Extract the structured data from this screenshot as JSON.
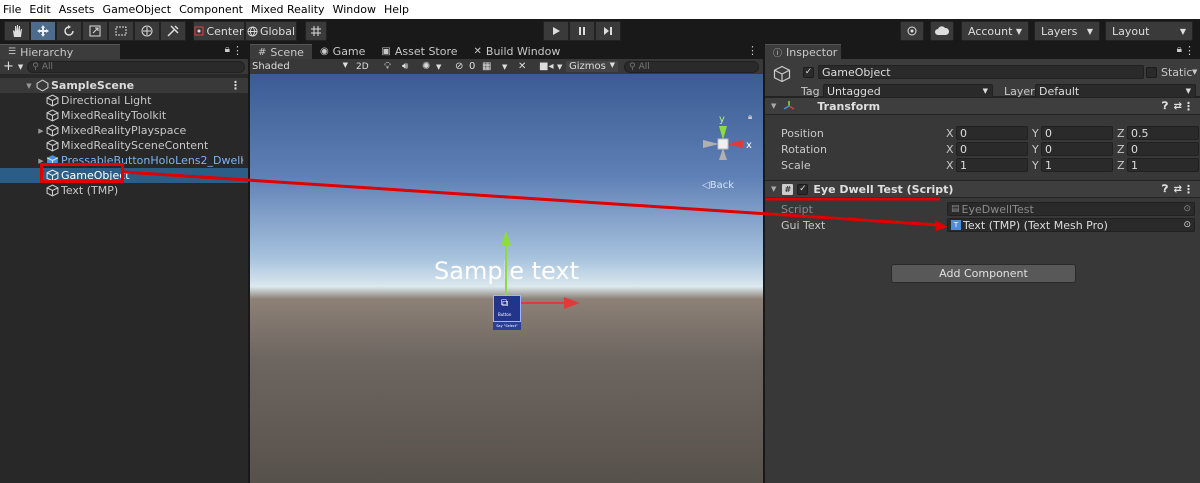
{
  "menu": [
    "File",
    "Edit",
    "Assets",
    "GameObject",
    "Component",
    "Mixed Reality",
    "Window",
    "Help"
  ],
  "toolbar": {
    "pivot_label": "Center",
    "space_label": "Global",
    "account_label": "Account",
    "layers_label": "Layers",
    "layout_label": "Layout"
  },
  "hierarchy": {
    "tab_label": "Hierarchy",
    "search_placeholder": "All",
    "scene_name": "SampleScene",
    "items": [
      {
        "label": "Directional Light"
      },
      {
        "label": "MixedRealityToolkit"
      },
      {
        "label": "MixedRealityPlayspace"
      },
      {
        "label": "MixedRealitySceneContent"
      },
      {
        "label": "PressableButtonHoloLens2_Dwell"
      },
      {
        "label": "GameObject"
      },
      {
        "label": "Text (TMP)"
      }
    ]
  },
  "scene": {
    "tabs": [
      "Scene",
      "Game",
      "Asset Store",
      "Build Window"
    ],
    "shading_label": "Shaded",
    "mode_2d_label": "2D",
    "fx_count": "0",
    "gizmos_label": "Gizmos",
    "search_placeholder": "All",
    "sample_text": "Sample text",
    "back_label": "Back",
    "gizmo_x": "x",
    "gizmo_y": "y",
    "button_caption": "Button",
    "button_sub": "Say \"Select\""
  },
  "inspector": {
    "tab_label": "Inspector",
    "object_name": "GameObject",
    "static_label": "Static",
    "tag_label": "Tag",
    "tag_value": "Untagged",
    "layer_label": "Layer",
    "layer_value": "Default",
    "transform": {
      "title": "Transform",
      "rows": [
        {
          "label": "Position",
          "x": "0",
          "y": "0",
          "z": "0.5"
        },
        {
          "label": "Rotation",
          "x": "0",
          "y": "0",
          "z": "0"
        },
        {
          "label": "Scale",
          "x": "1",
          "y": "1",
          "z": "1"
        }
      ],
      "axis_x": "X",
      "axis_y": "Y",
      "axis_z": "Z"
    },
    "script_component": {
      "title": "Eye Dwell Test (Script)",
      "script_label": "Script",
      "script_value": "EyeDwellTest",
      "gui_text_label": "Gui Text",
      "gui_text_value": "Text (TMP) (Text Mesh Pro)"
    },
    "add_component_label": "Add Component"
  },
  "colors": {
    "annotation_red": "#e00000",
    "selection_blue": "#2c5d87",
    "prefab_blue": "#7cb4f0"
  }
}
